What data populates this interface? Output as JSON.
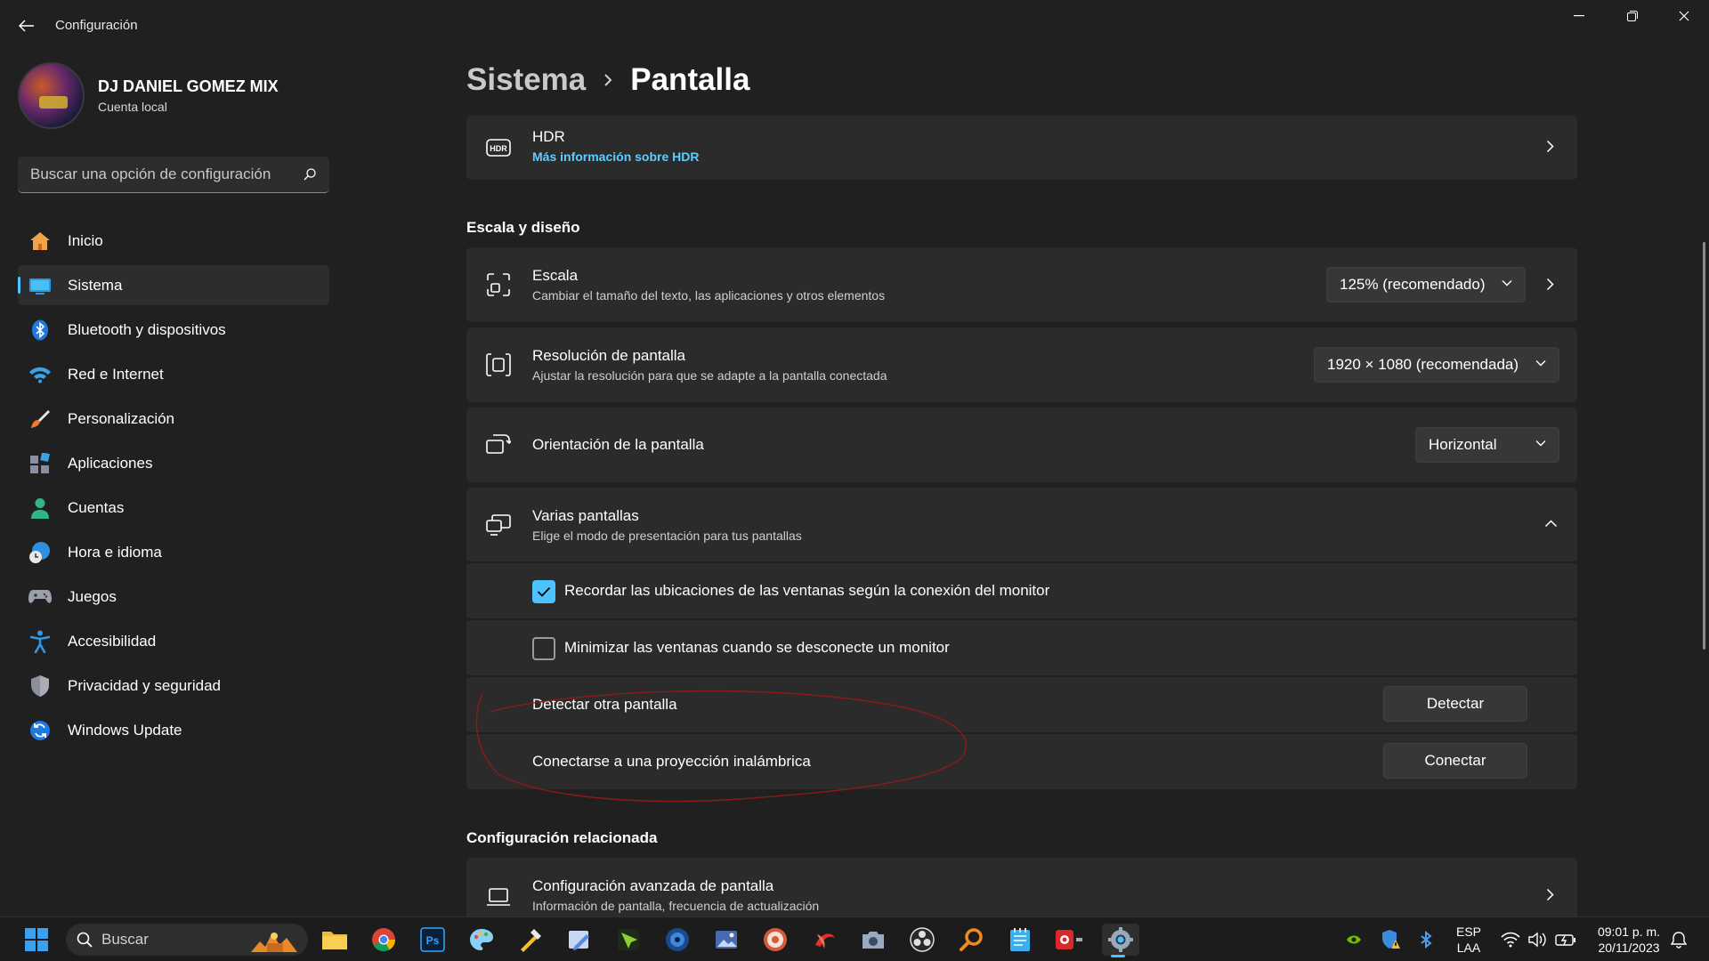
{
  "window": {
    "title": "Configuración"
  },
  "profile": {
    "name": "DJ DANIEL GOMEZ MIX",
    "account": "Cuenta local"
  },
  "search": {
    "placeholder": "Buscar una opción de configuración"
  },
  "sidebar": {
    "items": [
      {
        "label": "Inicio",
        "icon": "home-icon"
      },
      {
        "label": "Sistema",
        "icon": "system-icon",
        "active": true
      },
      {
        "label": "Bluetooth y dispositivos",
        "icon": "bluetooth-icon"
      },
      {
        "label": "Red e Internet",
        "icon": "wifi-icon"
      },
      {
        "label": "Personalización",
        "icon": "brush-icon"
      },
      {
        "label": "Aplicaciones",
        "icon": "apps-icon"
      },
      {
        "label": "Cuentas",
        "icon": "person-icon"
      },
      {
        "label": "Hora e idioma",
        "icon": "globe-clock-icon"
      },
      {
        "label": "Juegos",
        "icon": "gamepad-icon"
      },
      {
        "label": "Accesibilidad",
        "icon": "accessibility-icon"
      },
      {
        "label": "Privacidad y seguridad",
        "icon": "shield-icon"
      },
      {
        "label": "Windows Update",
        "icon": "update-icon"
      }
    ]
  },
  "breadcrumb": {
    "parent": "Sistema",
    "current": "Pantalla"
  },
  "hdr": {
    "title": "HDR",
    "link": "Más información sobre HDR"
  },
  "scale_section": {
    "title": "Escala y diseño",
    "scale": {
      "title": "Escala",
      "subtitle": "Cambiar el tamaño del texto, las aplicaciones y otros elementos",
      "value": "125% (recomendado)"
    },
    "resolution": {
      "title": "Resolución de pantalla",
      "subtitle": "Ajustar la resolución para que se adapte a la pantalla conectada",
      "value": "1920 × 1080 (recomendada)"
    },
    "orientation": {
      "title": "Orientación de la pantalla",
      "value": "Horizontal"
    },
    "multi": {
      "title": "Varias pantallas",
      "subtitle": "Elige el modo de presentación para tus pantallas",
      "remember_label": "Recordar las ubicaciones de las ventanas según la conexión del monitor",
      "remember_checked": true,
      "minimize_label": "Minimizar las ventanas cuando se desconecte un monitor",
      "minimize_checked": false,
      "detect_label": "Detectar otra pantalla",
      "detect_button": "Detectar",
      "connect_label": "Conectarse a una proyección inalámbrica",
      "connect_button": "Conectar"
    }
  },
  "related": {
    "title": "Configuración relacionada",
    "advanced": {
      "title": "Configuración avanzada de pantalla",
      "subtitle": "Información de pantalla, frecuencia de actualización"
    }
  },
  "taskbar": {
    "search_label": "Buscar",
    "lang_top": "ESP",
    "lang_bottom": "LAA",
    "time": "09:01 p. m.",
    "date": "20/11/2023"
  },
  "colors": {
    "accent": "#4cc2ff",
    "link": "#60cdff",
    "annotation": "#8b1a1a"
  }
}
